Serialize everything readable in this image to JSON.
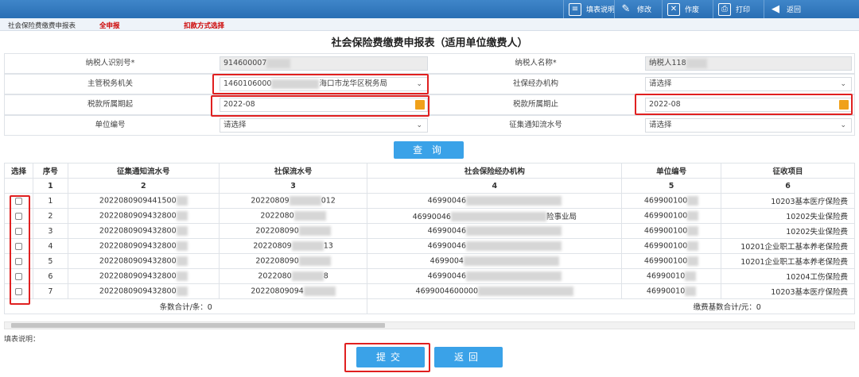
{
  "toolbar": {
    "fill_guide": "填表说明",
    "modify": "修改",
    "void": "作废",
    "print": "打印",
    "back": "返回"
  },
  "subnav": {
    "item1": "社会保险费缴费申报表",
    "item2": "全申报",
    "item3": "扣款方式选择"
  },
  "title": "社会保险费缴费申报表（适用单位缴费人）",
  "form": {
    "taxpayer_id_label": "纳税人识别号*",
    "taxpayer_id_value": "914600007",
    "taxpayer_name_label": "纳税人名称*",
    "taxpayer_name_value": "纳税人118",
    "tax_authority_label": "主管税务机关",
    "tax_authority_value_prefix": "1460106000",
    "tax_authority_value_suffix": "海口市龙华区税务局",
    "agency_label": "社保经办机构",
    "agency_value": "请选择",
    "period_start_label": "税款所属期起",
    "period_start_value": "2022-08",
    "period_end_label": "税款所属期止",
    "period_end_value": "2022-08",
    "unit_no_label": "单位编号",
    "unit_no_value": "请选择",
    "notice_no_label": "征集通知流水号",
    "notice_no_value": "请选择"
  },
  "query_button": "查 询",
  "table": {
    "headers": [
      "选择",
      "序号",
      "征集通知流水号",
      "社保流水号",
      "社会保险经办机构",
      "单位编号",
      "征收项目"
    ],
    "index_row": [
      "",
      "1",
      "2",
      "3",
      "4",
      "5",
      "6"
    ],
    "rows": [
      {
        "seq": "1",
        "notice": "2022080909441500",
        "ss": "20220809",
        "ss_tail": "012",
        "agency": "46990046",
        "agency_tail": "",
        "unit": "469900100",
        "item": "10203基本医疗保险费"
      },
      {
        "seq": "2",
        "notice": "2022080909432800",
        "ss": "2022080",
        "ss_tail": "",
        "agency": "46990046",
        "agency_tail": "险事业局",
        "unit": "469900100",
        "item": "10202失业保险费"
      },
      {
        "seq": "3",
        "notice": "2022080909432800",
        "ss": "202208090",
        "ss_tail": "",
        "agency": "46990046",
        "agency_tail": "",
        "unit": "469900100",
        "item": "10202失业保险费"
      },
      {
        "seq": "4",
        "notice": "2022080909432800",
        "ss": "20220809",
        "ss_tail": "13",
        "agency": "46990046",
        "agency_tail": "",
        "unit": "469900100",
        "item": "10201企业职工基本养老保险费"
      },
      {
        "seq": "5",
        "notice": "2022080909432800",
        "ss": "202208090",
        "ss_tail": "",
        "agency": "4699004",
        "agency_tail": "",
        "unit": "469900100",
        "item": "10201企业职工基本养老保险费"
      },
      {
        "seq": "6",
        "notice": "2022080909432800",
        "ss": "2022080",
        "ss_tail": "8",
        "agency": "46990046",
        "agency_tail": "",
        "unit": "46990010",
        "item": "10204工伤保险费"
      },
      {
        "seq": "7",
        "notice": "2022080909432800",
        "ss": "20220809094",
        "ss_tail": "",
        "agency": "4699004600000",
        "agency_tail": "",
        "unit": "46990010",
        "item": "10203基本医疗保险费"
      }
    ],
    "count_label": "条数合计/条：0",
    "base_total_label": "缴费基数合计/元：0"
  },
  "note": "填表说明：",
  "submit": "提交",
  "back_button": "返回",
  "colors": {
    "toolbar": "#2f79bf",
    "button": "#3aa2e8",
    "highlight": "#e02020",
    "calendar": "#f0a11a"
  }
}
